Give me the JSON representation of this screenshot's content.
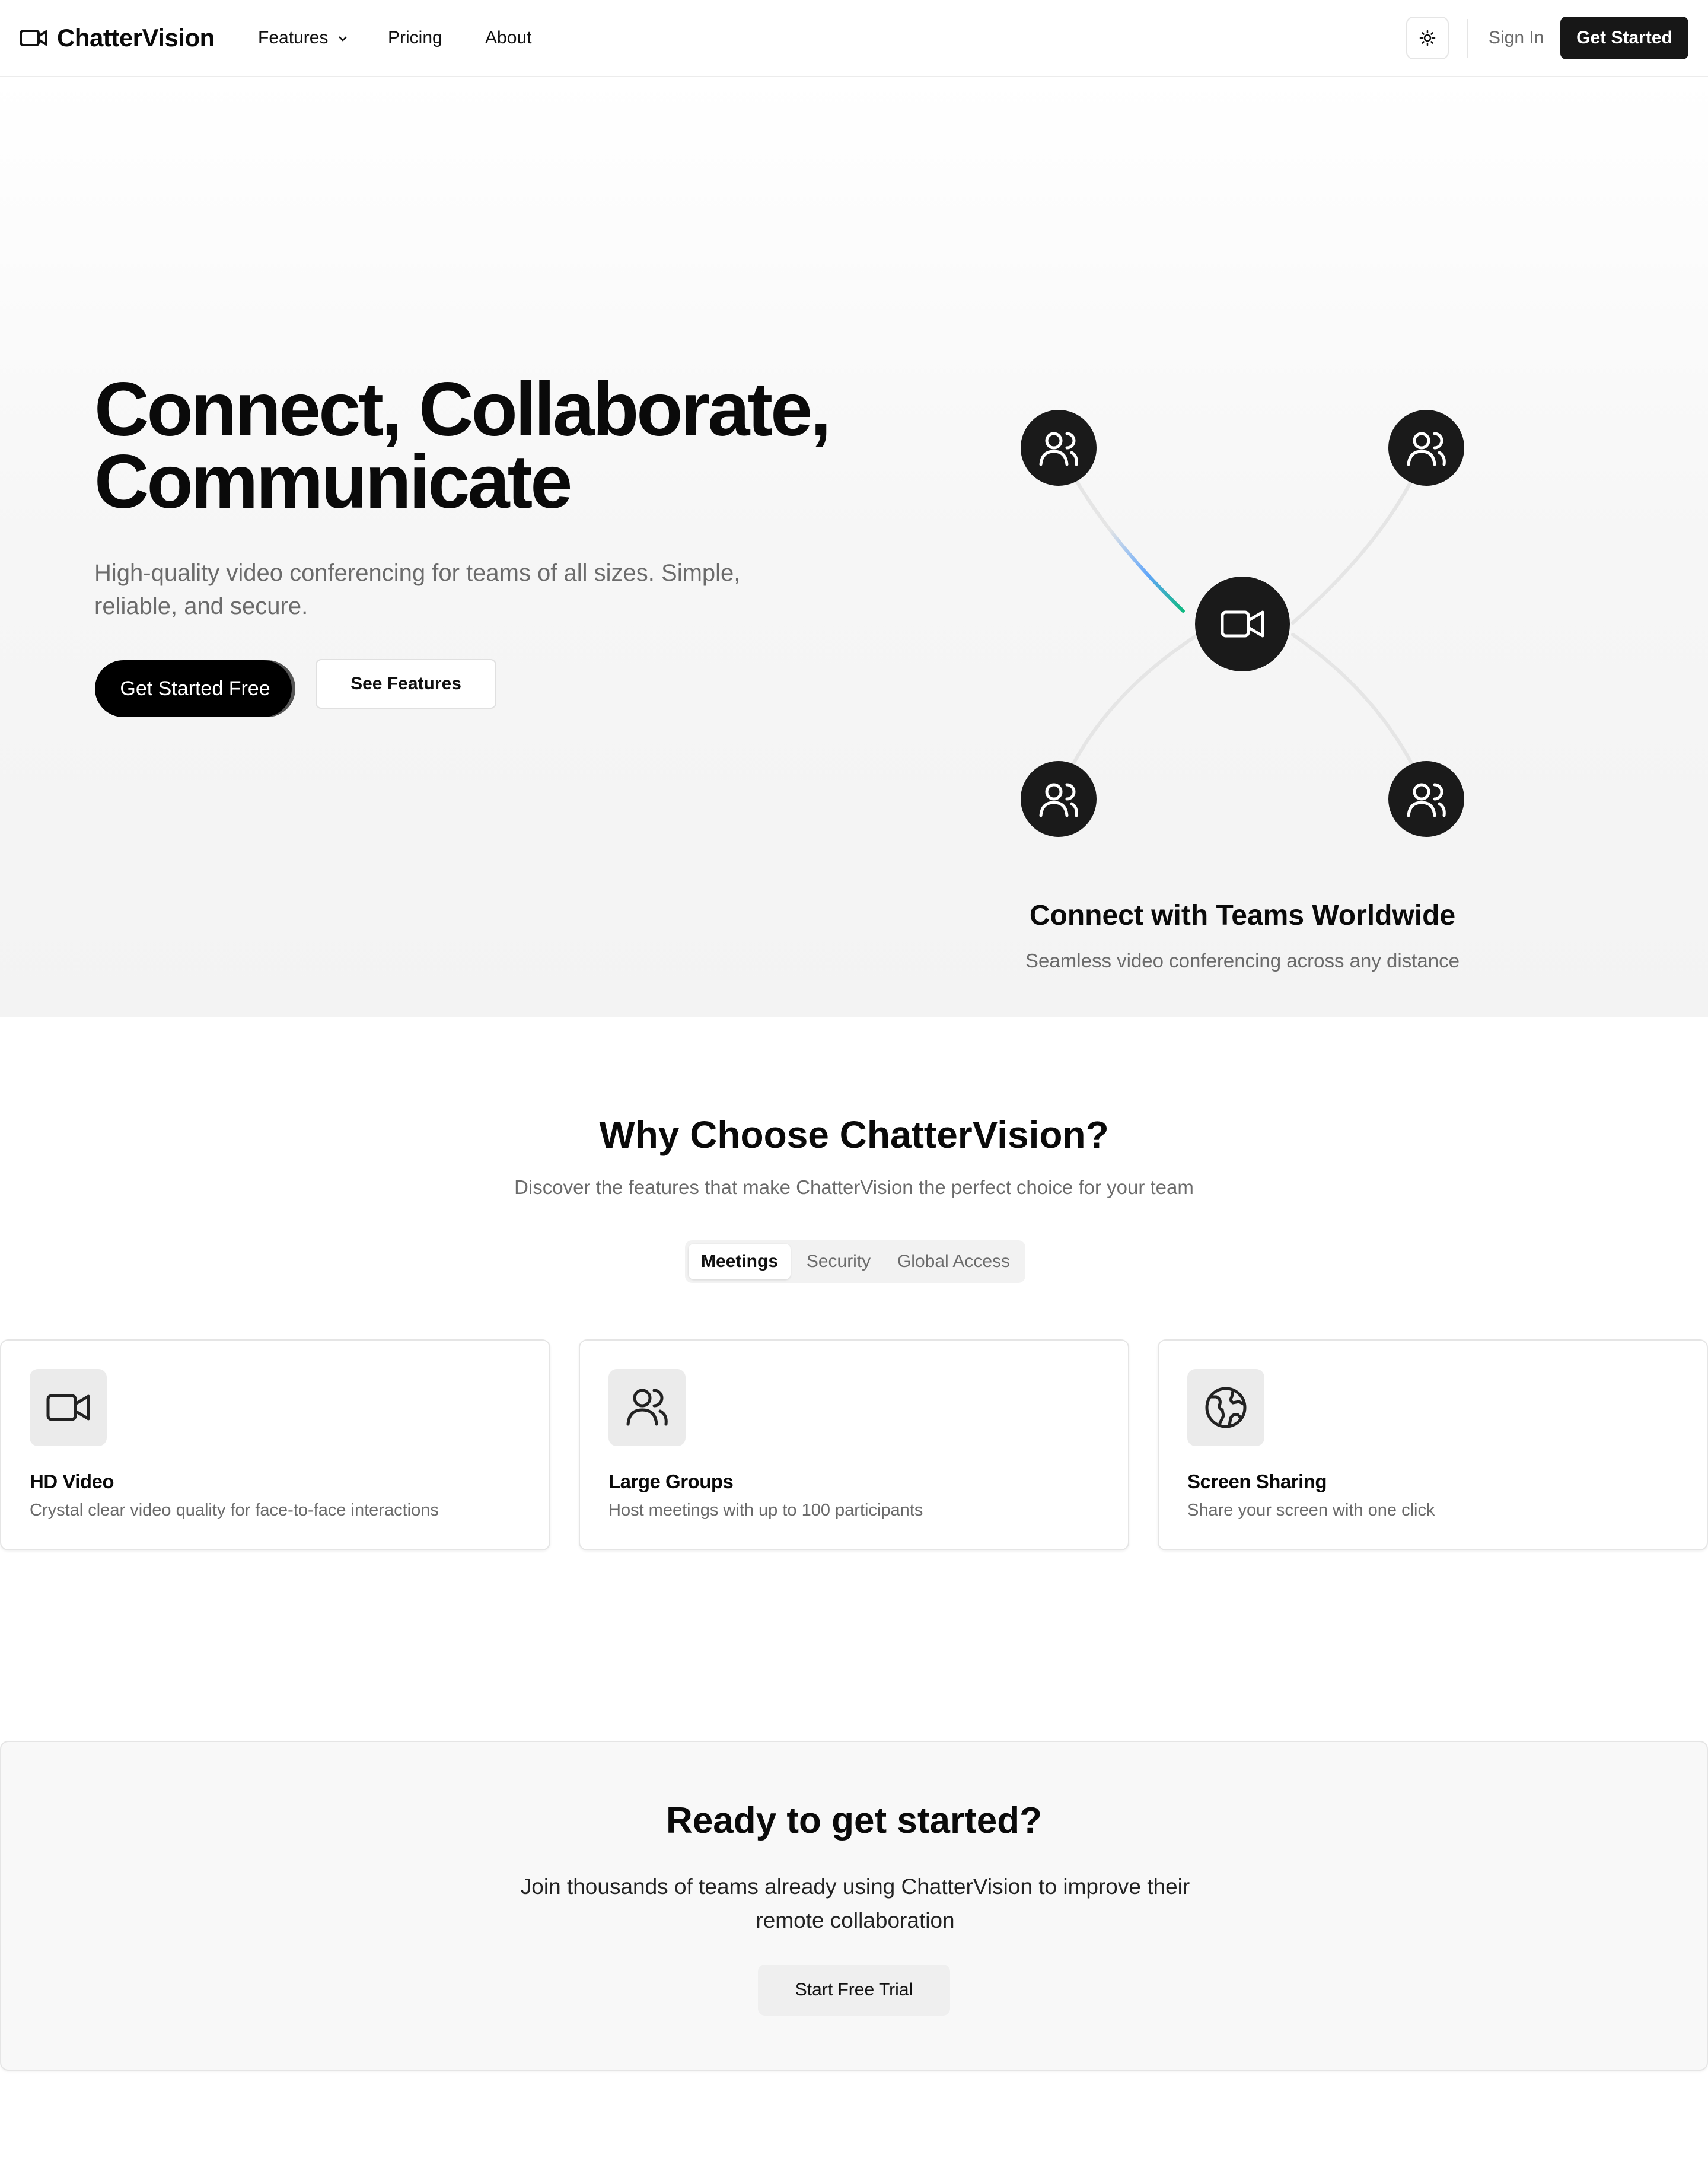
{
  "header": {
    "brand": "ChatterVision",
    "nav": [
      "Features",
      "Pricing",
      "About"
    ],
    "sign_in": "Sign In",
    "get_started": "Get Started"
  },
  "hero": {
    "title_line1": "Connect, Collaborate,",
    "title_line2": "Communicate",
    "subtitle": "High-quality video conferencing for teams of all sizes. Simple, reliable, and secure.",
    "primary_button": "Get Started Free",
    "secondary_button": "See Features",
    "network_title": "Connect with Teams Worldwide",
    "network_subtitle": "Seamless video conferencing across any distance"
  },
  "features": {
    "title": "Why Choose ChatterVision?",
    "subtitle": "Discover the features that make ChatterVision the perfect choice for your team",
    "tabs": [
      "Meetings",
      "Security",
      "Global Access"
    ],
    "active_tab": "Meetings",
    "cards": [
      {
        "icon": "video-camera-icon",
        "title": "HD Video",
        "description": "Crystal clear video quality for face-to-face interactions"
      },
      {
        "icon": "users-icon",
        "title": "Large Groups",
        "description": "Host meetings with up to 100 participants"
      },
      {
        "icon": "globe-icon",
        "title": "Screen Sharing",
        "description": "Share your screen with one click"
      }
    ]
  },
  "cta": {
    "title": "Ready to get started?",
    "subtitle": "Join thousands of teams already using ChatterVision to improve their remote collaboration",
    "button": "Start Free Trial"
  },
  "colors": {
    "brand_dark": "#171717",
    "muted_text": "#6b6b6b",
    "accent_gradient": [
      "#3b82f6",
      "#10b981"
    ]
  }
}
